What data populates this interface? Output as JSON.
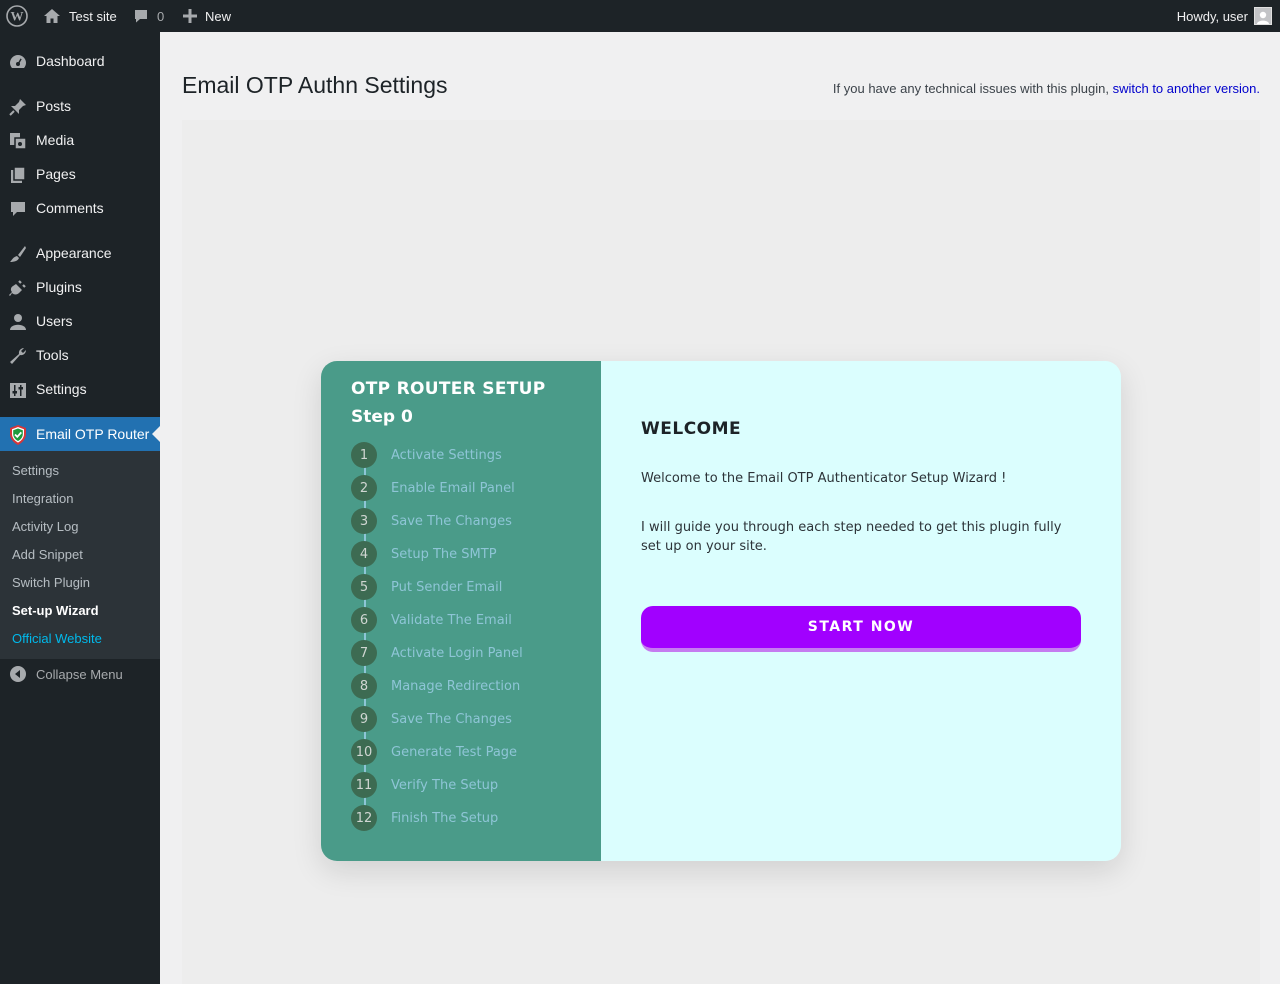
{
  "adminbar": {
    "site_name": "Test site",
    "comments_count": "0",
    "new_label": "New",
    "howdy": "Howdy, user"
  },
  "sidebar": {
    "items": [
      {
        "label": "Dashboard",
        "icon": "dashboard-icon"
      },
      {
        "label": "Posts",
        "icon": "pin-icon"
      },
      {
        "label": "Media",
        "icon": "media-icon"
      },
      {
        "label": "Pages",
        "icon": "pages-icon"
      },
      {
        "label": "Comments",
        "icon": "comment-icon"
      },
      {
        "label": "Appearance",
        "icon": "brush-icon"
      },
      {
        "label": "Plugins",
        "icon": "plug-icon"
      },
      {
        "label": "Users",
        "icon": "user-icon"
      },
      {
        "label": "Tools",
        "icon": "wrench-icon"
      },
      {
        "label": "Settings",
        "icon": "sliders-icon"
      },
      {
        "label": "Email OTP Router",
        "icon": "shield-check-icon"
      }
    ],
    "submenu": [
      {
        "label": "Settings"
      },
      {
        "label": "Integration"
      },
      {
        "label": "Activity Log"
      },
      {
        "label": "Add Snippet"
      },
      {
        "label": "Switch Plugin"
      },
      {
        "label": "Set-up Wizard"
      },
      {
        "label": "Official Website"
      }
    ],
    "collapse_label": "Collapse Menu"
  },
  "main": {
    "title": "Email OTP Authn Settings",
    "notice_text": "If you have any technical issues with this plugin,",
    "notice_link": "switch to another version."
  },
  "wizard": {
    "heading": "OTP ROUTER SETUP",
    "step": "Step 0",
    "steps": [
      {
        "num": "1",
        "label": "Activate Settings"
      },
      {
        "num": "2",
        "label": "Enable Email Panel"
      },
      {
        "num": "3",
        "label": "Save The Changes"
      },
      {
        "num": "4",
        "label": "Setup The SMTP"
      },
      {
        "num": "5",
        "label": "Put Sender Email"
      },
      {
        "num": "6",
        "label": "Validate The Email"
      },
      {
        "num": "7",
        "label": "Activate Login Panel"
      },
      {
        "num": "8",
        "label": "Manage Redirection"
      },
      {
        "num": "9",
        "label": "Save The Changes"
      },
      {
        "num": "10",
        "label": "Generate Test Page"
      },
      {
        "num": "11",
        "label": "Verify The Setup"
      },
      {
        "num": "12",
        "label": "Finish The Setup"
      }
    ],
    "welcome": "WELCOME",
    "para1": "Welcome to the Email OTP Authenticator Setup Wizard !",
    "para2": "I will guide you through each step needed to get this plugin fully set up on your site.",
    "button": "START  NOW"
  },
  "colors": {
    "admin_dark": "#1d2327",
    "accent_blue": "#2271b1",
    "wizard_green": "#4a9b89",
    "wizard_panel": "#dbfefe",
    "button_purple": "#a100ff",
    "step_circle": "#3d6b52"
  }
}
